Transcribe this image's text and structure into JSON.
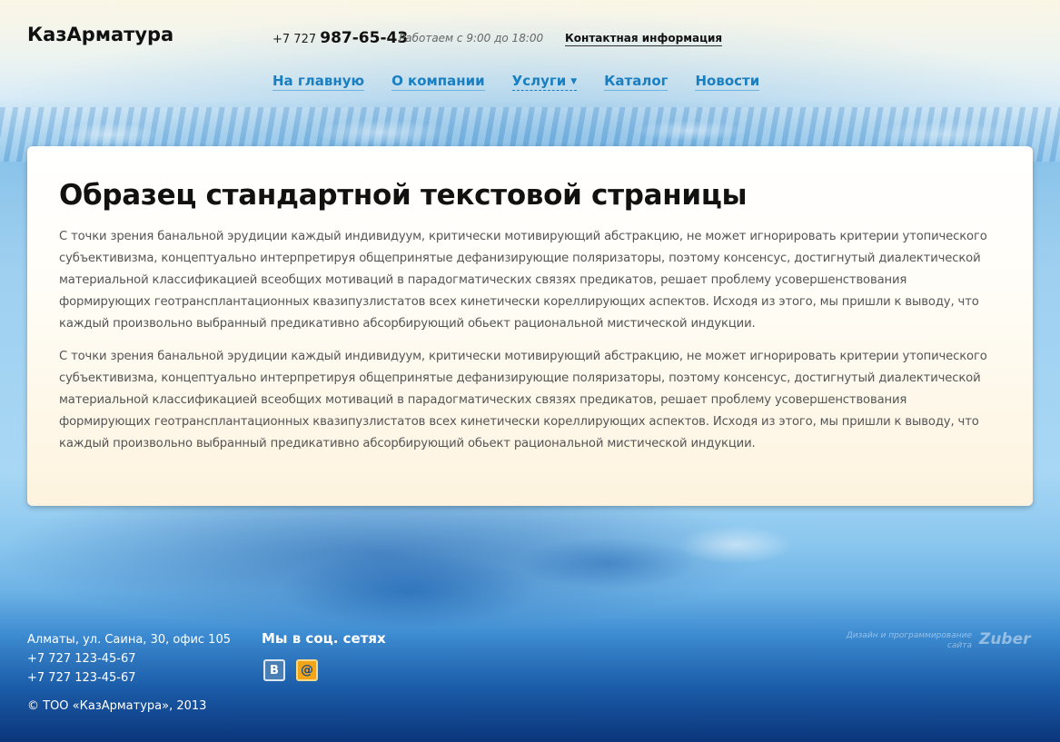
{
  "header": {
    "logo": "КазАрматура",
    "phone_prefix": "+7 727 ",
    "phone_number": "987-65-43",
    "hours": "Работаем с 9:00 до 18:00",
    "contact_link": "Контактная информация"
  },
  "nav": {
    "items": [
      {
        "label": "На главную"
      },
      {
        "label": "О компании"
      },
      {
        "label": "Услуги",
        "caret": "▼"
      },
      {
        "label": "Каталог"
      },
      {
        "label": "Новости"
      }
    ]
  },
  "content": {
    "title": "Образец стандартной текстовой страницы",
    "paragraphs": [
      "С точки зрения банальной эрудиции каждый индивидуум, критически мотивирующий абстракцию, не может игнорировать критерии утопического субъективизма, концептуально интерпретируя общепринятые дефанизирующие поляризаторы, поэтому консенсус, достигнутый диалектической материальной классификацией всеобщих мотиваций в парадогматических связях предикатов, решает проблему усовершенствования формирующих геотрансплантационных квазипузлистатов всех кинетически кореллирующих аспектов. Исходя из этого, мы пришли к выводу, что каждый произвольно выбранный предикативно абсорбирующий обьект рациональной мистической индукции.",
      "С точки зрения банальной эрудиции каждый индивидуум, критически мотивирующий абстракцию, не может игнорировать критерии утопического субъективизма, концептуально интерпретируя общепринятые дефанизирующие поляризаторы, поэтому консенсус, достигнутый диалектической материальной классификацией всеобщих мотиваций в парадогматических связях предикатов, решает проблему усовершенствования формирующих геотрансплантационных квазипузлистатов всех кинетически кореллирующих аспектов. Исходя из этого, мы пришли к выводу, что каждый произвольно выбранный предикативно абсорбирующий обьект рациональной мистической индукции."
    ]
  },
  "footer": {
    "address": "Алматы, ул. Саина, 30, офис 105",
    "phone1": "+7 727 123-45-67",
    "phone2": "+7 727 123-45-67",
    "copyright": "© ТОО «КазАрматура», 2013",
    "social_title": "Мы в соц. сетях",
    "social": {
      "vk": "В",
      "mail": "@"
    },
    "credit_line1": "Дизайн и программирование",
    "credit_line2": "сайта",
    "credit_logo": "Zuber"
  }
}
